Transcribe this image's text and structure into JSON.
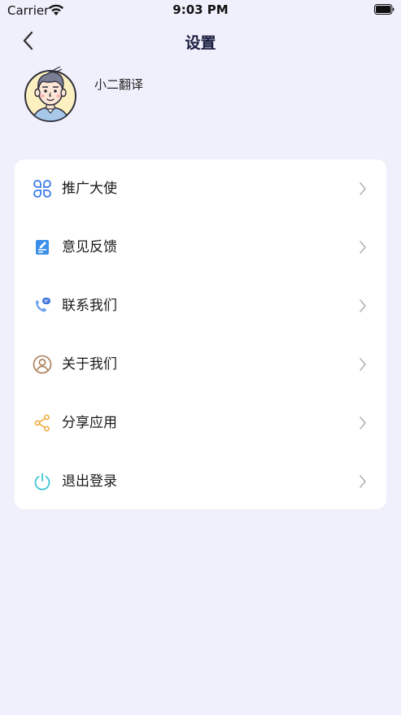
{
  "status_bar": {
    "carrier": "Carrier",
    "time": "9:03 PM"
  },
  "nav": {
    "title": "设置"
  },
  "profile": {
    "name": "小二翻译"
  },
  "menu": {
    "items": [
      {
        "label": "推广大使",
        "icon": "grid-icon"
      },
      {
        "label": "意见反馈",
        "icon": "feedback-icon"
      },
      {
        "label": "联系我们",
        "icon": "phone-icon"
      },
      {
        "label": "关于我们",
        "icon": "user-circle-icon"
      },
      {
        "label": "分享应用",
        "icon": "share-icon"
      },
      {
        "label": "退出登录",
        "icon": "power-icon"
      }
    ]
  },
  "colors": {
    "background": "#f0f0fc",
    "card": "#ffffff",
    "title": "#1a1d3f",
    "icon_blue": "#3a7be8",
    "icon_brown": "#a87b52",
    "icon_orange": "#f0a636",
    "icon_cyan": "#3ec6d6"
  }
}
